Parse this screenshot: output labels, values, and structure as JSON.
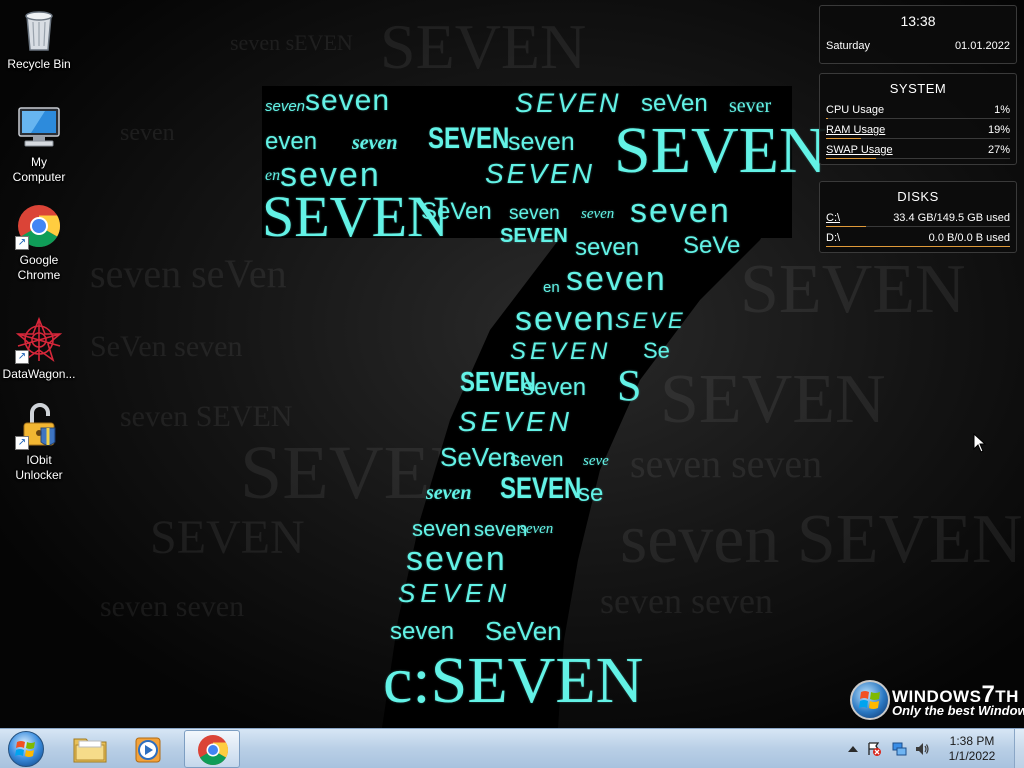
{
  "desktop_icons": [
    {
      "label": "Recycle Bin",
      "icon": "recycle-bin-icon"
    },
    {
      "label": "My\nComputer",
      "label_line1": "My",
      "label_line2": "Computer",
      "icon": "computer-icon"
    },
    {
      "label_line1": "Google",
      "label_line2": "Chrome",
      "icon": "chrome-icon"
    },
    {
      "label_line1": "DataWagon...",
      "icon": "datawagon-icon"
    },
    {
      "label_line1": "IObit",
      "label_line2": "Unlocker",
      "icon": "unlock-icon"
    }
  ],
  "gadgets": {
    "clock": {
      "time": "13:38",
      "day": "Saturday",
      "date": "01.01.2022"
    },
    "system": {
      "title": "SYSTEM",
      "rows": [
        {
          "label": "CPU Usage",
          "value": "1%",
          "fraction": 0.01
        },
        {
          "label": "RAM Usage",
          "value": "19%",
          "fraction": 0.19
        },
        {
          "label": "SWAP Usage",
          "value": "27%",
          "fraction": 0.27
        }
      ]
    },
    "disks": {
      "title": "DISKS",
      "rows": [
        {
          "label": "C:\\",
          "value": "33.4 GB/149.5 GB used",
          "fraction": 0.22
        },
        {
          "label": "D:\\",
          "value": "0.0 B/0.0 B used",
          "fraction": 0.0
        }
      ]
    }
  },
  "wallpaper": {
    "words": [
      "seven",
      "SEVEN",
      "SeVen"
    ],
    "accent": "#63f2e6"
  },
  "logo": {
    "line1_a": "WINDOWS",
    "line1_b": "7",
    "line1_c": "TH",
    "line2": "Only the best Window"
  },
  "taskbar": {
    "buttons": [
      {
        "name": "start-button",
        "icon": "windows-orb-icon"
      },
      {
        "name": "explorer-button",
        "icon": "folder-icon"
      },
      {
        "name": "media-player-button",
        "icon": "media-player-icon"
      },
      {
        "name": "chrome-button",
        "icon": "chrome-icon",
        "active": true
      }
    ],
    "tray_icons": [
      "show-hidden-icons-icon",
      "action-center-icon",
      "network-icon",
      "volume-icon"
    ],
    "clock_time": "1:38 PM",
    "clock_date": "1/1/2022"
  }
}
